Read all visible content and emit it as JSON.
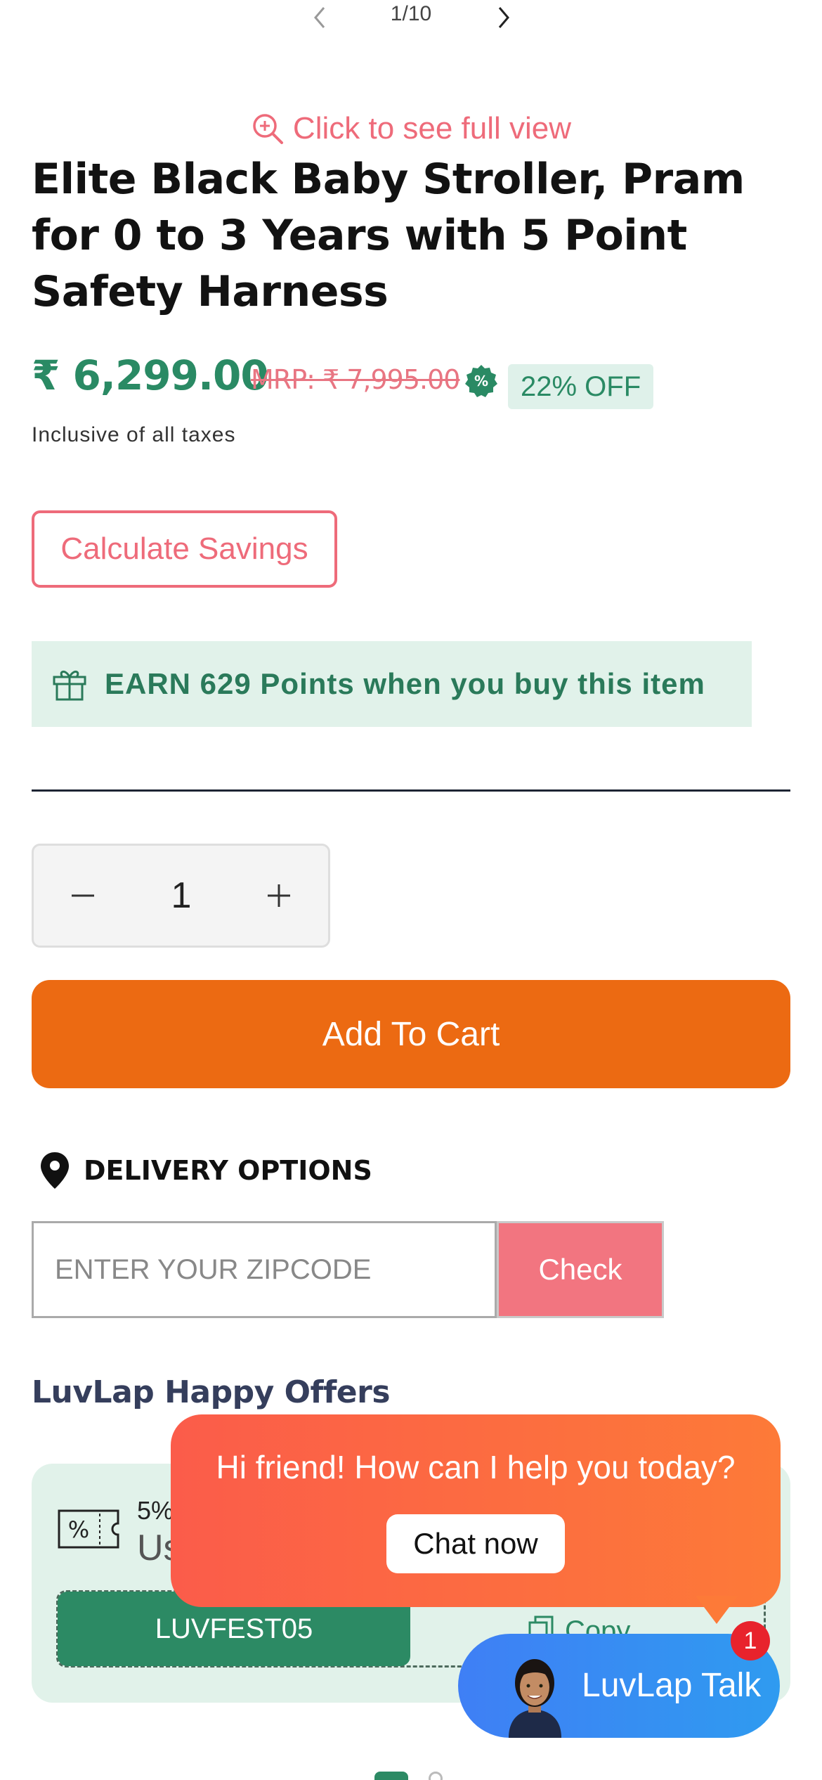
{
  "pager": {
    "count": "1/10",
    "prev_icon": "chevron-left-icon",
    "next_icon": "chevron-right-icon"
  },
  "full_view": {
    "label": "Click to see full view",
    "icon": "zoom-in-icon"
  },
  "product": {
    "title": "Elite Black Baby Stroller, Pram for 0 to 3 Years with 5 Point Safety Harness",
    "price": "₹ 6,299.00",
    "mrp": "MRP: ₹ 7,995.00",
    "discount": "22% OFF",
    "taxes_note": "Inclusive of all taxes"
  },
  "calculate_savings": "Calculate Savings",
  "earn_points": "EARN 629 Points when you buy this item",
  "quantity": {
    "value": "1",
    "minus_icon": "minus-icon",
    "plus_icon": "plus-icon"
  },
  "add_to_cart": "Add To Cart",
  "delivery": {
    "title": "DELIVERY OPTIONS",
    "placeholder": "ENTER YOUR ZIPCODE",
    "check_label": "Check"
  },
  "offers": {
    "title": "LuvLap Happy Offers",
    "line1": "5%",
    "line2": "Us",
    "code": "LUVFEST05",
    "copy_label": "Copy"
  },
  "chat": {
    "greeting": "Hi friend! How can I help you today?",
    "cta": "Chat now",
    "talk_label": "LuvLap Talk",
    "badge_count": "1"
  },
  "colors": {
    "brand_green": "#2a8a64",
    "accent_pink": "#ee6b7a",
    "cart_orange": "#ec6a12",
    "chat_orange": "#fd7a38",
    "talk_blue": "#3f7ff5"
  }
}
